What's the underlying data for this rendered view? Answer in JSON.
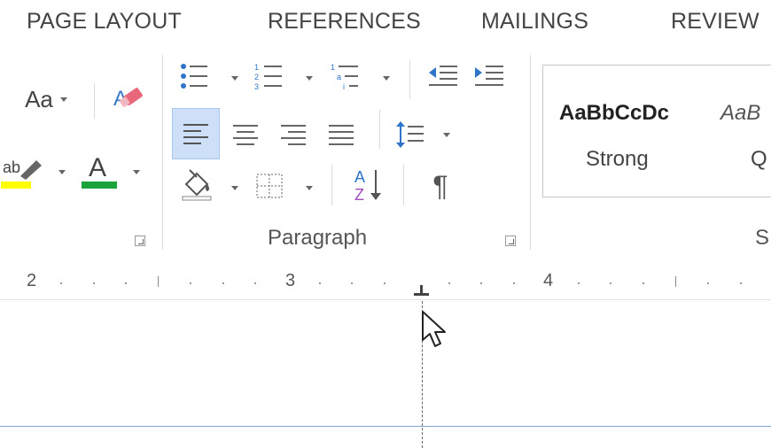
{
  "tabs": [
    {
      "label": "PAGE LAYOUT"
    },
    {
      "label": "REFERENCES"
    },
    {
      "label": "MAILINGS"
    },
    {
      "label": "REVIEW"
    }
  ],
  "font_group": {
    "change_case_label": "Aa",
    "highlight_label": "ab",
    "font_color_label": "A",
    "highlight_color": "#ffff00",
    "font_color": "#1aa33a"
  },
  "paragraph_group": {
    "label": "Paragraph",
    "sort_label_top": "A",
    "sort_label_bottom": "Z",
    "show_marks_glyph": "¶"
  },
  "styles_group": {
    "items": [
      {
        "preview": "AaBbCcDc",
        "name": "Strong"
      },
      {
        "preview": "AaB",
        "name": "Q"
      }
    ],
    "label_partial": "S"
  },
  "ruler": {
    "numbers": [
      "2",
      "3",
      "4"
    ]
  },
  "colors": {
    "accent": "#cde0f7",
    "margin_line": "#7ea7d8"
  }
}
